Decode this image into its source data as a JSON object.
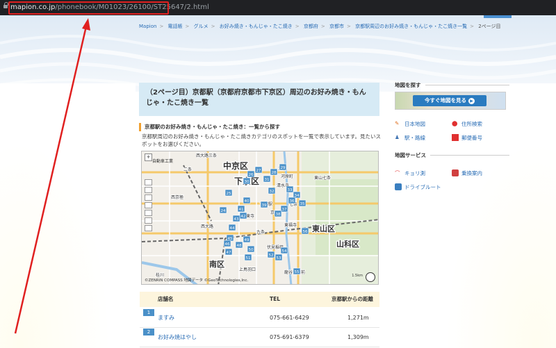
{
  "browser": {
    "url_host": "mapion.co.jp",
    "url_path": "/phonebook/M01023/26100/ST25647/2.html"
  },
  "breadcrumb": [
    "Mapion",
    "電話帳",
    "グルメ",
    "お好み焼き・もんじゃ・たこ焼き",
    "京都府",
    "京都市",
    "京都駅周辺のお好み焼き・もんじゃ・たこ焼き一覧",
    "2ページ目"
  ],
  "page": {
    "title": "（2ページ目）京都駅（京都府京都市下京区）周辺のお好み焼き・もんじゃ・たこ焼き一覧",
    "section_heading": "京都駅のお好み焼き・もんじゃ・たこ焼き：一覧から探す",
    "description": "京都駅周辺のお好み焼き・もんじゃ・たこ焼きカテゴリのスポットを一覧で表示しています。見たいスポットをお選びください。"
  },
  "map": {
    "zoom_label": "自動車工業",
    "district_labels": [
      "中京区",
      "下京区",
      "東山区",
      "山科区",
      "南区"
    ],
    "small_labels": [
      "西大路三条",
      "二条",
      "三条",
      "西京極",
      "東寺",
      "九条",
      "七条",
      "京都",
      "西大路",
      "桂川",
      "伏見稲荷",
      "上鳥羽口",
      "龍谷大学前",
      "京都駅",
      "河原町",
      "東福寺",
      "清水寺",
      "東山七条"
    ],
    "copyright": "©ZENRIN COMPASS 地図データ ©GeoTechnologies,Inc.",
    "scale": "1.5km",
    "markers": [
      "24",
      "25",
      "26",
      "27",
      "28",
      "29",
      "30",
      "31",
      "32",
      "33",
      "34",
      "35",
      "36",
      "37",
      "38",
      "39",
      "40",
      "41",
      "42",
      "43",
      "44",
      "45",
      "46",
      "47",
      "48",
      "49",
      "50",
      "51",
      "52",
      "53",
      "54",
      "55",
      "56"
    ]
  },
  "table": {
    "headers": [
      "店舗名",
      "TEL",
      "京都駅からの距離"
    ],
    "rows": [
      {
        "num": "1",
        "name": "ますみ",
        "tel": "075-661-6429",
        "distance": "1,271m"
      },
      {
        "num": "2",
        "name": "お好み焼はやし",
        "tel": "075-691-6379",
        "distance": "1,309m"
      }
    ]
  },
  "sidebar": {
    "find_map_title": "地図を探す",
    "map_button": "今すぐ地図を見る",
    "links": [
      "日本地図",
      "住所検索",
      "駅・路線",
      "郵便番号"
    ],
    "services_title": "地図サービス",
    "service_links": [
      "キョリ測",
      "乗換案内",
      "ドライブルート"
    ]
  },
  "colors": {
    "accent": "#2a7bc0",
    "title_bg": "#d6eaf5",
    "table_head_bg": "#fdf5dd",
    "annotation_red": "#e02020"
  }
}
